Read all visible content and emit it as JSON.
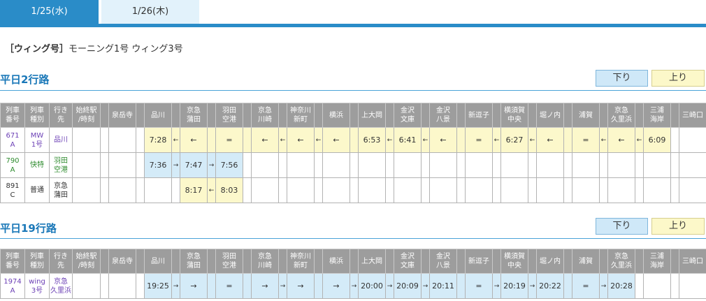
{
  "tabs": [
    {
      "label": "1/25(水)"
    },
    {
      "label": "1/26(木)"
    }
  ],
  "title": {
    "tag": "［ウィング号］",
    "text": "モーニング1号 ウィング3号"
  },
  "colors": {
    "accent": "#2a8cc8",
    "heading": "#1a78b8",
    "header_bg": "#9d9d9d",
    "up_bg": "#fcf8cb",
    "down_bg": "#d4ebf8"
  },
  "columns": {
    "train_no": "列車\n番号",
    "train_type": "列車\n種別",
    "destination": "行き\n先",
    "origin": "始終駅\n/時刻",
    "stations": [
      "泉岳寺",
      "品川",
      "京急\n蒲田",
      "羽田\n空港",
      "京急\n川崎",
      "神奈川\n新町",
      "横浜",
      "上大岡",
      "金沢\n文庫",
      "金沢\n八景",
      "新逗子",
      "横須賀\n中央",
      "堀ノ内",
      "浦賀",
      "京急\n久里浜",
      "三浦\n海岸",
      "三崎口"
    ]
  },
  "sections": [
    {
      "heading": "平日2行路",
      "down_label": "下り",
      "up_label": "上り",
      "rows": [
        {
          "train_no": "671\nA",
          "train_type": "MW\n1号",
          "destination": "品川",
          "direction": "up",
          "text_color": "#6b3fb5",
          "stops": [
            [
              "",
              ""
            ],
            [
              "7:28",
              "←"
            ],
            [
              "←",
              ""
            ],
            [
              "=",
              ""
            ],
            [
              "←",
              "←"
            ],
            [
              "←",
              "←"
            ],
            [
              "←",
              ""
            ],
            [
              "6:53",
              "←"
            ],
            [
              "6:41",
              "←"
            ],
            [
              "←",
              ""
            ],
            [
              "=",
              "←"
            ],
            [
              "6:27",
              "←"
            ],
            [
              "←",
              ""
            ],
            [
              "=",
              "←"
            ],
            [
              "←",
              "←"
            ],
            [
              "6:09",
              ""
            ],
            [
              ""
            ]
          ]
        },
        {
          "train_no": "790\nA",
          "train_type": "快特",
          "destination": "羽田\n空港",
          "direction": "down",
          "text_color": "#2e8b2e",
          "stops": [
            [
              "",
              ""
            ],
            [
              "7:36",
              "→"
            ],
            [
              "7:47",
              "→"
            ],
            [
              "7:56",
              ""
            ],
            [
              "",
              ""
            ],
            [
              "",
              ""
            ],
            [
              "",
              ""
            ],
            [
              "",
              ""
            ],
            [
              "",
              ""
            ],
            [
              "",
              ""
            ],
            [
              "",
              ""
            ],
            [
              "",
              ""
            ],
            [
              "",
              ""
            ],
            [
              "",
              ""
            ],
            [
              "",
              ""
            ],
            [
              "",
              ""
            ],
            [
              ""
            ]
          ]
        },
        {
          "train_no": "891\nC",
          "train_type": "普通",
          "destination": "京急\n蒲田",
          "direction": "up",
          "text_color": "#333333",
          "stops": [
            [
              "",
              ""
            ],
            [
              "",
              ""
            ],
            [
              "8:17",
              "←"
            ],
            [
              "8:03",
              ""
            ],
            [
              "",
              ""
            ],
            [
              "",
              ""
            ],
            [
              "",
              ""
            ],
            [
              "",
              ""
            ],
            [
              "",
              ""
            ],
            [
              "",
              ""
            ],
            [
              "",
              ""
            ],
            [
              "",
              ""
            ],
            [
              "",
              ""
            ],
            [
              "",
              ""
            ],
            [
              "",
              ""
            ],
            [
              "",
              ""
            ],
            [
              ""
            ]
          ]
        }
      ]
    },
    {
      "heading": "平日19行路",
      "down_label": "下り",
      "up_label": "上り",
      "rows": [
        {
          "train_no": "1974\nA",
          "train_type": "wing\n3号",
          "destination": "京急\n久里浜",
          "direction": "down",
          "text_color": "#6b3fb5",
          "stops": [
            [
              "",
              ""
            ],
            [
              "19:25",
              "→"
            ],
            [
              "→",
              ""
            ],
            [
              "=",
              ""
            ],
            [
              "→",
              "→"
            ],
            [
              "→",
              ""
            ],
            [
              "→",
              "→"
            ],
            [
              "20:00",
              "→"
            ],
            [
              "20:09",
              "→"
            ],
            [
              "20:11",
              ""
            ],
            [
              "=",
              "→"
            ],
            [
              "20:19",
              "→"
            ],
            [
              "20:22",
              ""
            ],
            [
              "=",
              "→"
            ],
            [
              "20:28",
              ""
            ],
            [
              "",
              ""
            ],
            [
              ""
            ]
          ]
        }
      ]
    }
  ]
}
